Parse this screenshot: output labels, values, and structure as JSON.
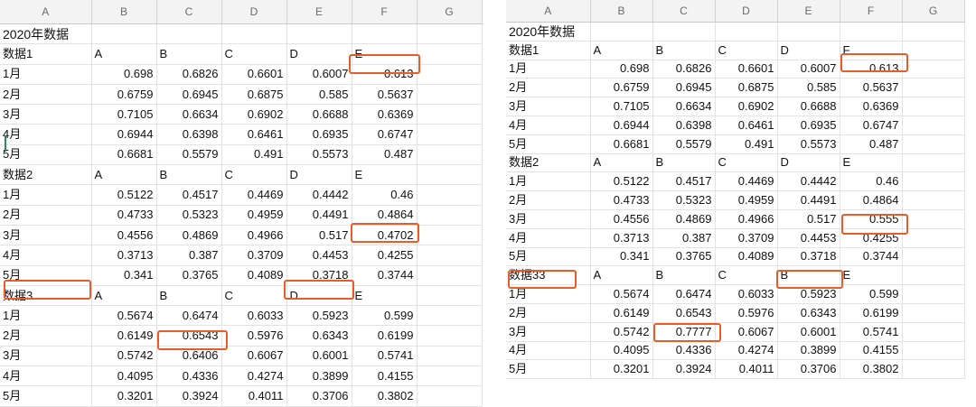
{
  "columns": [
    "A",
    "B",
    "C",
    "D",
    "E",
    "F",
    "G"
  ],
  "left": {
    "rows": [
      [
        "2020年数据",
        "",
        "",
        "",
        "",
        "",
        ""
      ],
      [
        "数据1",
        "A",
        "B",
        "C",
        "D",
        "E",
        ""
      ],
      [
        "1月",
        "0.698",
        "0.6826",
        "0.6601",
        "0.6007",
        "0.613",
        ""
      ],
      [
        "2月",
        "0.6759",
        "0.6945",
        "0.6875",
        "0.585",
        "0.5637",
        ""
      ],
      [
        "3月",
        "0.7105",
        "0.6634",
        "0.6902",
        "0.6688",
        "0.6369",
        ""
      ],
      [
        "4月",
        "0.6944",
        "0.6398",
        "0.6461",
        "0.6935",
        "0.6747",
        ""
      ],
      [
        "5月",
        "0.6681",
        "0.5579",
        "0.491",
        "0.5573",
        "0.487",
        ""
      ],
      [
        "数据2",
        "A",
        "B",
        "C",
        "D",
        "E",
        ""
      ],
      [
        "1月",
        "0.5122",
        "0.4517",
        "0.4469",
        "0.4442",
        "0.46",
        ""
      ],
      [
        "2月",
        "0.4733",
        "0.5323",
        "0.4959",
        "0.4491",
        "0.4864",
        ""
      ],
      [
        "3月",
        "0.4556",
        "0.4869",
        "0.4966",
        "0.517",
        "0.4702",
        ""
      ],
      [
        "4月",
        "0.3713",
        "0.387",
        "0.3709",
        "0.4453",
        "0.4255",
        ""
      ],
      [
        "5月",
        "0.341",
        "0.3765",
        "0.4089",
        "0.3718",
        "0.3744",
        ""
      ],
      [
        "数据3",
        "A",
        "B",
        "C",
        "D",
        "E",
        ""
      ],
      [
        "1月",
        "0.5674",
        "0.6474",
        "0.6033",
        "0.5923",
        "0.599",
        ""
      ],
      [
        "2月",
        "0.6149",
        "0.6543",
        "0.5976",
        "0.6343",
        "0.6199",
        ""
      ],
      [
        "3月",
        "0.5742",
        "0.6406",
        "0.6067",
        "0.6001",
        "0.5741",
        ""
      ],
      [
        "4月",
        "0.4095",
        "0.4336",
        "0.4274",
        "0.3899",
        "0.4155",
        ""
      ],
      [
        "5月",
        "0.3201",
        "0.3924",
        "0.4011",
        "0.3706",
        "0.3802",
        ""
      ]
    ]
  },
  "right": {
    "rows": [
      [
        "2020年数据",
        "",
        "",
        "",
        "",
        "",
        ""
      ],
      [
        "数据1",
        "A",
        "B",
        "C",
        "D",
        "F",
        ""
      ],
      [
        "1月",
        "0.698",
        "0.6826",
        "0.6601",
        "0.6007",
        "0.613",
        ""
      ],
      [
        "2月",
        "0.6759",
        "0.6945",
        "0.6875",
        "0.585",
        "0.5637",
        ""
      ],
      [
        "3月",
        "0.7105",
        "0.6634",
        "0.6902",
        "0.6688",
        "0.6369",
        ""
      ],
      [
        "4月",
        "0.6944",
        "0.6398",
        "0.6461",
        "0.6935",
        "0.6747",
        ""
      ],
      [
        "5月",
        "0.6681",
        "0.5579",
        "0.491",
        "0.5573",
        "0.487",
        ""
      ],
      [
        "数据2",
        "A",
        "B",
        "C",
        "D",
        "E",
        ""
      ],
      [
        "1月",
        "0.5122",
        "0.4517",
        "0.4469",
        "0.4442",
        "0.46",
        ""
      ],
      [
        "2月",
        "0.4733",
        "0.5323",
        "0.4959",
        "0.4491",
        "0.4864",
        ""
      ],
      [
        "3月",
        "0.4556",
        "0.4869",
        "0.4966",
        "0.517",
        "0.555",
        ""
      ],
      [
        "4月",
        "0.3713",
        "0.387",
        "0.3709",
        "0.4453",
        "0.4255",
        ""
      ],
      [
        "5月",
        "0.341",
        "0.3765",
        "0.4089",
        "0.3718",
        "0.3744",
        ""
      ],
      [
        "数据33",
        "A",
        "B",
        "C",
        "B",
        "E",
        ""
      ],
      [
        "1月",
        "0.5674",
        "0.6474",
        "0.6033",
        "0.5923",
        "0.599",
        ""
      ],
      [
        "2月",
        "0.6149",
        "0.6543",
        "0.5976",
        "0.6343",
        "0.6199",
        ""
      ],
      [
        "3月",
        "0.5742",
        "0.7777",
        "0.6067",
        "0.6001",
        "0.5741",
        ""
      ],
      [
        "4月",
        "0.4095",
        "0.4336",
        "0.4274",
        "0.3899",
        "0.4155",
        ""
      ],
      [
        "5月",
        "0.3201",
        "0.3924",
        "0.4011",
        "0.3706",
        "0.3802",
        ""
      ]
    ]
  },
  "colors": {
    "highlight": "#e85c2b",
    "row_marker": "#2e8b57"
  }
}
